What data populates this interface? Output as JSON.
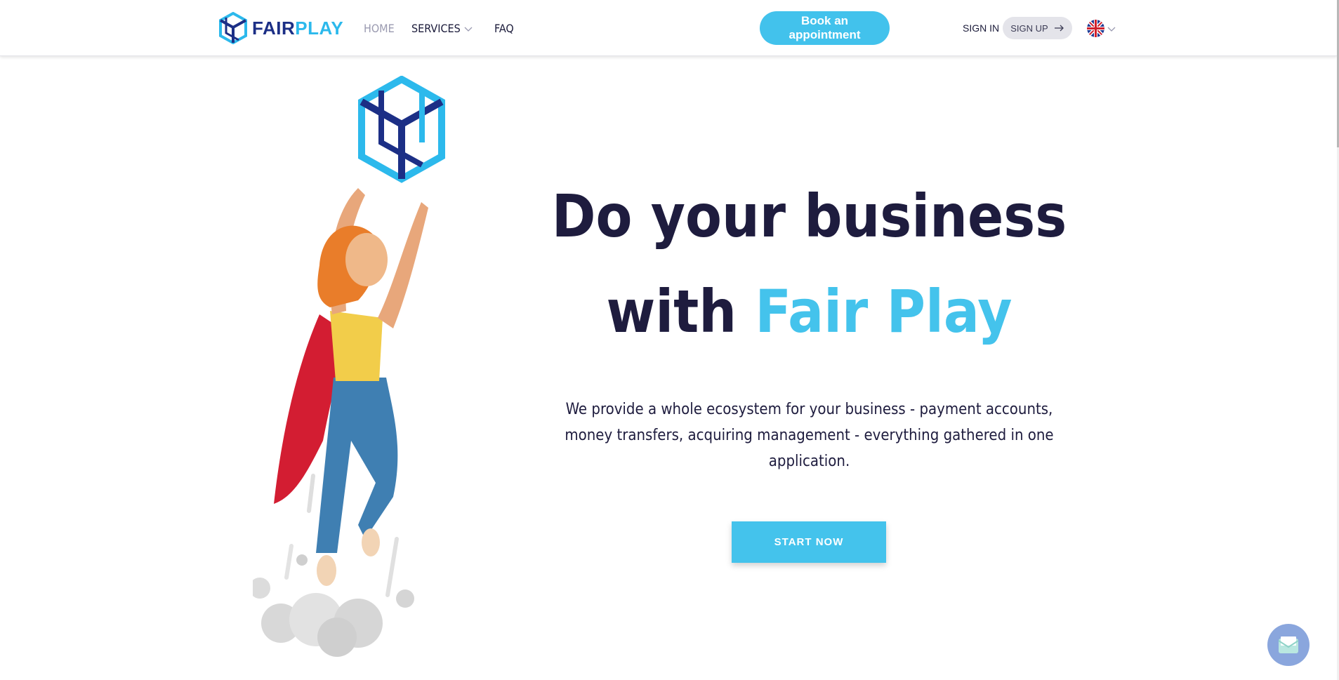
{
  "brand": {
    "name_part1": "FAIR",
    "name_part2": "PLAY",
    "colors": {
      "dark_blue": "#1c2f86",
      "light_blue": "#2cb9ec",
      "accent": "#44c3ec",
      "text_dark": "#1e1c3e"
    }
  },
  "nav": {
    "items": [
      {
        "label": "HOME",
        "active": true
      },
      {
        "label": "SERVICES",
        "has_dropdown": true
      },
      {
        "label": "FAQ"
      }
    ]
  },
  "header": {
    "book_button": "Book an appointment",
    "sign_in": "SIGN IN",
    "sign_up": "SIGN UP",
    "language_icon": "uk-flag-icon"
  },
  "hero": {
    "title_line1": "Do your business",
    "title_line2_prefix": "with ",
    "title_line2_accent": "Fair Play",
    "description": "We provide a whole ecosystem for your business - payment accounts, money transfers, acquiring management - everything gathered in one application.",
    "cta": "START NOW"
  },
  "icons": {
    "logo": "fairplay-logo-icon",
    "services_dropdown": "chevron-down-icon",
    "sign_up_arrow": "arrow-right-icon",
    "chat": "chat-envelope-icon"
  }
}
